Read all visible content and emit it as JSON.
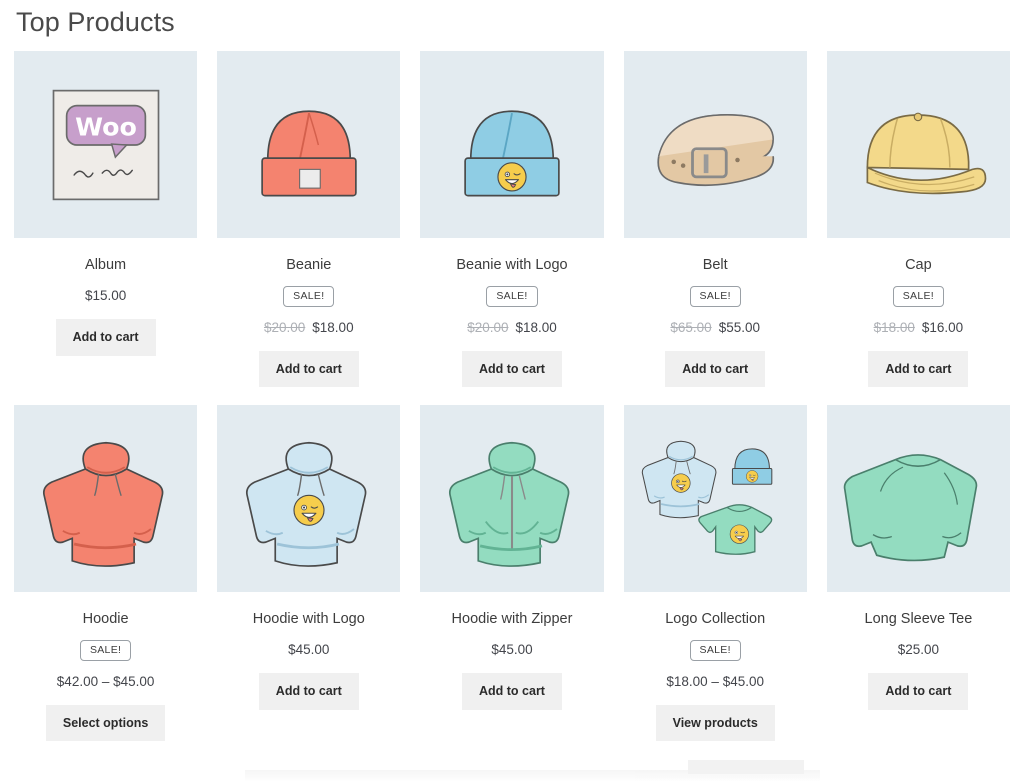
{
  "header": {
    "title": "Top Products"
  },
  "labels": {
    "sale_badge": "SALE!",
    "add_to_cart": "Add to cart",
    "select_options": "Select options",
    "view_products": "View products"
  },
  "colors": {
    "thumb_background": "#e3ebf0",
    "button_background": "#f0f0f0",
    "title_text": "#4a4a4a",
    "price_text": "#55575c",
    "old_price_text": "#adb0b5",
    "salmon": "#f4836f",
    "light_blue": "#8fcde4",
    "pale_blue": "#cfe6f2",
    "mint": "#93dcc0",
    "tan": "#e3c8a4",
    "gold": "#f3d98a",
    "purple": "#c79fcb"
  },
  "products": [
    {
      "name": "Album",
      "image": "album-cover",
      "on_sale": false,
      "price": "$15.00",
      "old_price": "",
      "action": "Add to cart",
      "action_name": "add-to-cart-button"
    },
    {
      "name": "Beanie",
      "image": "beanie-salmon",
      "on_sale": true,
      "price": "$18.00",
      "old_price": "$20.00",
      "action": "Add to cart",
      "action_name": "add-to-cart-button"
    },
    {
      "name": "Beanie with Logo",
      "image": "beanie-blue-logo",
      "on_sale": true,
      "price": "$18.00",
      "old_price": "$20.00",
      "action": "Add to cart",
      "action_name": "add-to-cart-button"
    },
    {
      "name": "Belt",
      "image": "belt-tan",
      "on_sale": true,
      "price": "$55.00",
      "old_price": "$65.00",
      "action": "Add to cart",
      "action_name": "add-to-cart-button"
    },
    {
      "name": "Cap",
      "image": "cap-gold",
      "on_sale": true,
      "price": "$16.00",
      "old_price": "$18.00",
      "action": "Add to cart",
      "action_name": "add-to-cart-button"
    },
    {
      "name": "Hoodie",
      "image": "hoodie-salmon",
      "on_sale": true,
      "price": "$42.00 – $45.00",
      "old_price": "",
      "action": "Select options",
      "action_name": "select-options-button"
    },
    {
      "name": "Hoodie with Logo",
      "image": "hoodie-blue-logo",
      "on_sale": false,
      "price": "$45.00",
      "old_price": "",
      "action": "Add to cart",
      "action_name": "add-to-cart-button"
    },
    {
      "name": "Hoodie with Zipper",
      "image": "hoodie-mint-zipper",
      "on_sale": false,
      "price": "$45.00",
      "old_price": "",
      "action": "Add to cart",
      "action_name": "add-to-cart-button"
    },
    {
      "name": "Logo Collection",
      "image": "logo-collection",
      "on_sale": true,
      "price": "$18.00 – $45.00",
      "old_price": "",
      "action": "View products",
      "action_name": "view-products-button"
    },
    {
      "name": "Long Sleeve Tee",
      "image": "tee-mint-longsleeve",
      "on_sale": false,
      "price": "$25.00",
      "old_price": "",
      "action": "Add to cart",
      "action_name": "add-to-cart-button"
    }
  ]
}
